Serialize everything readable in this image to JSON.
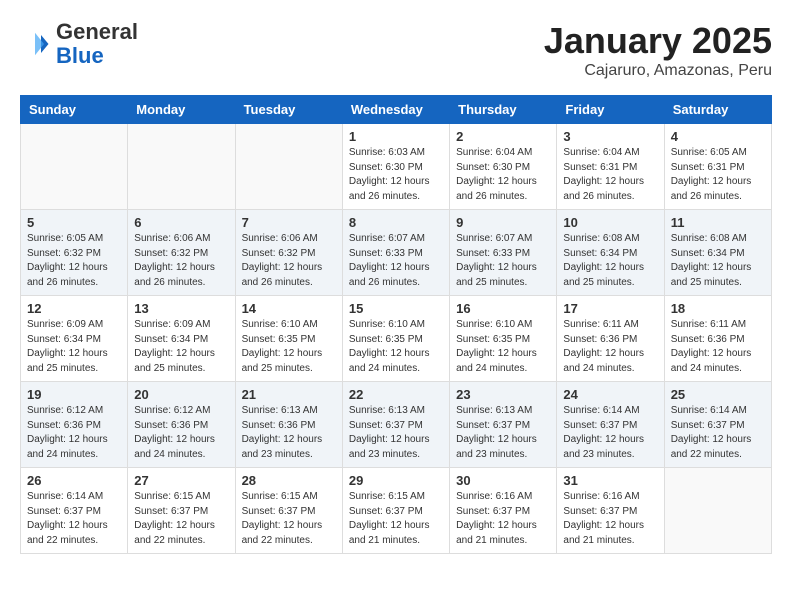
{
  "logo": {
    "general": "General",
    "blue": "Blue"
  },
  "header": {
    "month": "January 2025",
    "location": "Cajaruro, Amazonas, Peru"
  },
  "weekdays": [
    "Sunday",
    "Monday",
    "Tuesday",
    "Wednesday",
    "Thursday",
    "Friday",
    "Saturday"
  ],
  "weeks": [
    [
      {
        "day": "",
        "info": ""
      },
      {
        "day": "",
        "info": ""
      },
      {
        "day": "",
        "info": ""
      },
      {
        "day": "1",
        "info": "Sunrise: 6:03 AM\nSunset: 6:30 PM\nDaylight: 12 hours\nand 26 minutes."
      },
      {
        "day": "2",
        "info": "Sunrise: 6:04 AM\nSunset: 6:30 PM\nDaylight: 12 hours\nand 26 minutes."
      },
      {
        "day": "3",
        "info": "Sunrise: 6:04 AM\nSunset: 6:31 PM\nDaylight: 12 hours\nand 26 minutes."
      },
      {
        "day": "4",
        "info": "Sunrise: 6:05 AM\nSunset: 6:31 PM\nDaylight: 12 hours\nand 26 minutes."
      }
    ],
    [
      {
        "day": "5",
        "info": "Sunrise: 6:05 AM\nSunset: 6:32 PM\nDaylight: 12 hours\nand 26 minutes."
      },
      {
        "day": "6",
        "info": "Sunrise: 6:06 AM\nSunset: 6:32 PM\nDaylight: 12 hours\nand 26 minutes."
      },
      {
        "day": "7",
        "info": "Sunrise: 6:06 AM\nSunset: 6:32 PM\nDaylight: 12 hours\nand 26 minutes."
      },
      {
        "day": "8",
        "info": "Sunrise: 6:07 AM\nSunset: 6:33 PM\nDaylight: 12 hours\nand 26 minutes."
      },
      {
        "day": "9",
        "info": "Sunrise: 6:07 AM\nSunset: 6:33 PM\nDaylight: 12 hours\nand 25 minutes."
      },
      {
        "day": "10",
        "info": "Sunrise: 6:08 AM\nSunset: 6:34 PM\nDaylight: 12 hours\nand 25 minutes."
      },
      {
        "day": "11",
        "info": "Sunrise: 6:08 AM\nSunset: 6:34 PM\nDaylight: 12 hours\nand 25 minutes."
      }
    ],
    [
      {
        "day": "12",
        "info": "Sunrise: 6:09 AM\nSunset: 6:34 PM\nDaylight: 12 hours\nand 25 minutes."
      },
      {
        "day": "13",
        "info": "Sunrise: 6:09 AM\nSunset: 6:34 PM\nDaylight: 12 hours\nand 25 minutes."
      },
      {
        "day": "14",
        "info": "Sunrise: 6:10 AM\nSunset: 6:35 PM\nDaylight: 12 hours\nand 25 minutes."
      },
      {
        "day": "15",
        "info": "Sunrise: 6:10 AM\nSunset: 6:35 PM\nDaylight: 12 hours\nand 24 minutes."
      },
      {
        "day": "16",
        "info": "Sunrise: 6:10 AM\nSunset: 6:35 PM\nDaylight: 12 hours\nand 24 minutes."
      },
      {
        "day": "17",
        "info": "Sunrise: 6:11 AM\nSunset: 6:36 PM\nDaylight: 12 hours\nand 24 minutes."
      },
      {
        "day": "18",
        "info": "Sunrise: 6:11 AM\nSunset: 6:36 PM\nDaylight: 12 hours\nand 24 minutes."
      }
    ],
    [
      {
        "day": "19",
        "info": "Sunrise: 6:12 AM\nSunset: 6:36 PM\nDaylight: 12 hours\nand 24 minutes."
      },
      {
        "day": "20",
        "info": "Sunrise: 6:12 AM\nSunset: 6:36 PM\nDaylight: 12 hours\nand 24 minutes."
      },
      {
        "day": "21",
        "info": "Sunrise: 6:13 AM\nSunset: 6:36 PM\nDaylight: 12 hours\nand 23 minutes."
      },
      {
        "day": "22",
        "info": "Sunrise: 6:13 AM\nSunset: 6:37 PM\nDaylight: 12 hours\nand 23 minutes."
      },
      {
        "day": "23",
        "info": "Sunrise: 6:13 AM\nSunset: 6:37 PM\nDaylight: 12 hours\nand 23 minutes."
      },
      {
        "day": "24",
        "info": "Sunrise: 6:14 AM\nSunset: 6:37 PM\nDaylight: 12 hours\nand 23 minutes."
      },
      {
        "day": "25",
        "info": "Sunrise: 6:14 AM\nSunset: 6:37 PM\nDaylight: 12 hours\nand 22 minutes."
      }
    ],
    [
      {
        "day": "26",
        "info": "Sunrise: 6:14 AM\nSunset: 6:37 PM\nDaylight: 12 hours\nand 22 minutes."
      },
      {
        "day": "27",
        "info": "Sunrise: 6:15 AM\nSunset: 6:37 PM\nDaylight: 12 hours\nand 22 minutes."
      },
      {
        "day": "28",
        "info": "Sunrise: 6:15 AM\nSunset: 6:37 PM\nDaylight: 12 hours\nand 22 minutes."
      },
      {
        "day": "29",
        "info": "Sunrise: 6:15 AM\nSunset: 6:37 PM\nDaylight: 12 hours\nand 21 minutes."
      },
      {
        "day": "30",
        "info": "Sunrise: 6:16 AM\nSunset: 6:37 PM\nDaylight: 12 hours\nand 21 minutes."
      },
      {
        "day": "31",
        "info": "Sunrise: 6:16 AM\nSunset: 6:37 PM\nDaylight: 12 hours\nand 21 minutes."
      },
      {
        "day": "",
        "info": ""
      }
    ]
  ]
}
